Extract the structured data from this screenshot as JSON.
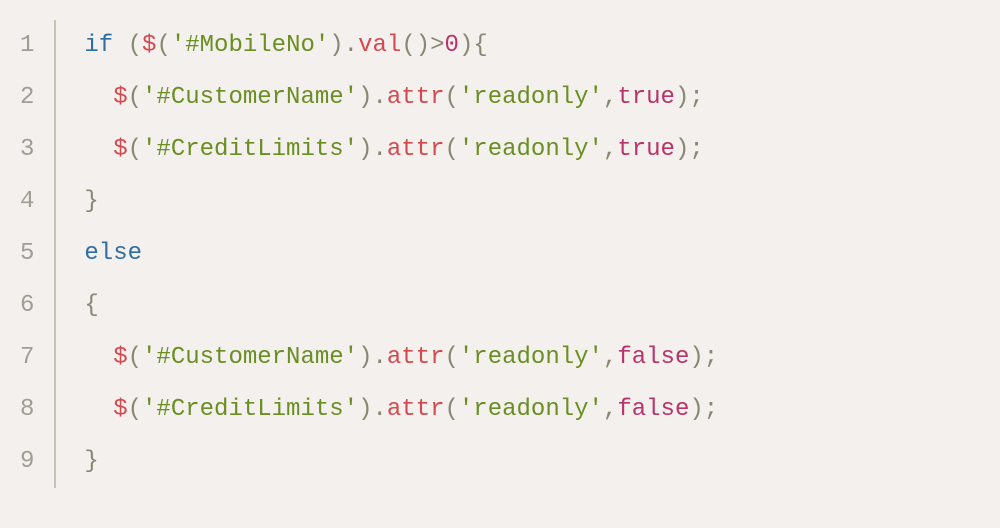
{
  "lines": [
    {
      "num": "1",
      "tokens": [
        {
          "cls": "kw",
          "t": "if"
        },
        {
          "cls": "plain",
          "t": " "
        },
        {
          "cls": "punct",
          "t": "("
        },
        {
          "cls": "fn",
          "t": "$"
        },
        {
          "cls": "punct",
          "t": "("
        },
        {
          "cls": "str",
          "t": "'#MobileNo'"
        },
        {
          "cls": "punct",
          "t": ")."
        },
        {
          "cls": "fn",
          "t": "val"
        },
        {
          "cls": "punct",
          "t": "()>"
        },
        {
          "cls": "num",
          "t": "0"
        },
        {
          "cls": "punct",
          "t": "){"
        }
      ]
    },
    {
      "num": "2",
      "tokens": [
        {
          "cls": "plain",
          "t": "  "
        },
        {
          "cls": "fn",
          "t": "$"
        },
        {
          "cls": "punct",
          "t": "("
        },
        {
          "cls": "str",
          "t": "'#CustomerName'"
        },
        {
          "cls": "punct",
          "t": ")."
        },
        {
          "cls": "fn",
          "t": "attr"
        },
        {
          "cls": "punct",
          "t": "("
        },
        {
          "cls": "str",
          "t": "'readonly'"
        },
        {
          "cls": "punct",
          "t": ","
        },
        {
          "cls": "bool",
          "t": "true"
        },
        {
          "cls": "punct",
          "t": ");"
        }
      ]
    },
    {
      "num": "3",
      "tokens": [
        {
          "cls": "plain",
          "t": "  "
        },
        {
          "cls": "fn",
          "t": "$"
        },
        {
          "cls": "punct",
          "t": "("
        },
        {
          "cls": "str",
          "t": "'#CreditLimits'"
        },
        {
          "cls": "punct",
          "t": ")."
        },
        {
          "cls": "fn",
          "t": "attr"
        },
        {
          "cls": "punct",
          "t": "("
        },
        {
          "cls": "str",
          "t": "'readonly'"
        },
        {
          "cls": "punct",
          "t": ","
        },
        {
          "cls": "bool",
          "t": "true"
        },
        {
          "cls": "punct",
          "t": ");"
        }
      ]
    },
    {
      "num": "4",
      "tokens": [
        {
          "cls": "punct",
          "t": "}"
        }
      ]
    },
    {
      "num": "5",
      "tokens": [
        {
          "cls": "kw",
          "t": "else"
        }
      ]
    },
    {
      "num": "6",
      "tokens": [
        {
          "cls": "punct",
          "t": "{"
        }
      ]
    },
    {
      "num": "7",
      "tokens": [
        {
          "cls": "plain",
          "t": "  "
        },
        {
          "cls": "fn",
          "t": "$"
        },
        {
          "cls": "punct",
          "t": "("
        },
        {
          "cls": "str",
          "t": "'#CustomerName'"
        },
        {
          "cls": "punct",
          "t": ")."
        },
        {
          "cls": "fn",
          "t": "attr"
        },
        {
          "cls": "punct",
          "t": "("
        },
        {
          "cls": "str",
          "t": "'readonly'"
        },
        {
          "cls": "punct",
          "t": ","
        },
        {
          "cls": "bool",
          "t": "false"
        },
        {
          "cls": "punct",
          "t": ");"
        }
      ]
    },
    {
      "num": "8",
      "tokens": [
        {
          "cls": "plain",
          "t": "  "
        },
        {
          "cls": "fn",
          "t": "$"
        },
        {
          "cls": "punct",
          "t": "("
        },
        {
          "cls": "str",
          "t": "'#CreditLimits'"
        },
        {
          "cls": "punct",
          "t": ")."
        },
        {
          "cls": "fn",
          "t": "attr"
        },
        {
          "cls": "punct",
          "t": "("
        },
        {
          "cls": "str",
          "t": "'readonly'"
        },
        {
          "cls": "punct",
          "t": ","
        },
        {
          "cls": "bool",
          "t": "false"
        },
        {
          "cls": "punct",
          "t": ");"
        }
      ]
    },
    {
      "num": "9",
      "tokens": [
        {
          "cls": "punct",
          "t": "}"
        }
      ]
    }
  ]
}
